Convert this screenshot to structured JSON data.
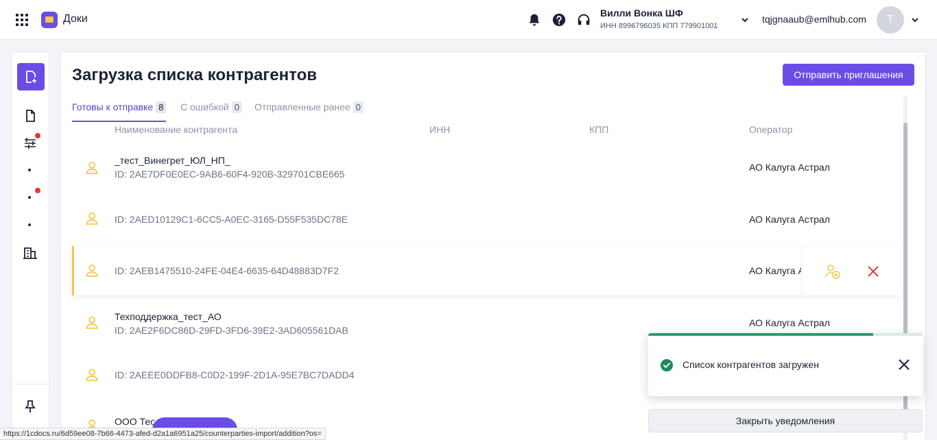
{
  "app": {
    "name": "Доки",
    "apps_icon": "apps-grid-icon",
    "logo_icon": "folder-icon"
  },
  "header": {
    "org": {
      "name": "Вилли Вонка ШФ",
      "details": "ИНН 8996796035  КПП 779901001"
    },
    "user": {
      "email": "tqjgnaaub@emlhub.com",
      "avatar_letter": "Т"
    },
    "icons": [
      "bell-icon",
      "help-icon",
      "headset-icon"
    ]
  },
  "sidebar": {
    "new_doc_icon": "new-document-icon",
    "items": [
      {
        "icon": "document-icon",
        "badge": false
      },
      {
        "icon": "transfer-icon",
        "badge": true
      },
      {
        "icon": "dot-icon",
        "badge": false
      },
      {
        "icon": "dot-icon",
        "badge": true
      },
      {
        "icon": "dot-icon",
        "badge": false
      },
      {
        "icon": "building-icon",
        "badge": false
      }
    ],
    "pin_icon": "pin-icon"
  },
  "page": {
    "title": "Загрузка списка контрагентов",
    "send_button": "Отправить приглашения",
    "tabs": [
      {
        "label": "Готовы к отправке",
        "count": "8",
        "active": true
      },
      {
        "label": "С ошибкой",
        "count": "0",
        "active": false
      },
      {
        "label": "Отправленные ранее",
        "count": "0",
        "active": false
      }
    ],
    "columns": {
      "name": "Наименование контрагента",
      "inn": "ИНН",
      "kpp": "КПП",
      "operator": "Оператор"
    },
    "rows": [
      {
        "name": "_тест_Винегрет_ЮЛ_НП_",
        "id": "ID: 2AE7DF0E0EC-9AB6-60F4-920B-329701CBE665",
        "operator": "АО Калуга Астрал"
      },
      {
        "name": "",
        "id": "ID: 2AED10129C1-6CC5-A0EC-3165-D55F535DC78E",
        "operator": "АО Калуга Астрал"
      },
      {
        "name": "",
        "id": "ID: 2AEB1475510-24FE-04E4-6635-64D48883D7F2",
        "operator": "АО Калуга Астрал"
      },
      {
        "name": "Техподдержка_тест_АО",
        "id": "ID: 2AE2F6DC86D-29FD-3FD6-39E2-3AD605561DAB",
        "operator": "АО Калуга Астрал"
      },
      {
        "name": "",
        "id": "ID: 2AEEE0DDFB8-C0D2-199F-2D1A-95E7BC7DADD4",
        "operator": ""
      },
      {
        "name": "ООО Тес",
        "id": "",
        "operator": ""
      }
    ]
  },
  "toast": {
    "text": "Список контрагентов загружен",
    "progress": 0.82,
    "close_all": "Закрыть уведомления"
  },
  "statusbar": {
    "url": "https://1cdocs.ru/6d59ee08-7b66-4473-afed-d2a1a6951a25/counterparties-import/addition?os="
  },
  "colors": {
    "accent": "#6b4ce6",
    "success": "#2e9c6a",
    "danger": "#e53935",
    "person": "#f2c94c"
  }
}
